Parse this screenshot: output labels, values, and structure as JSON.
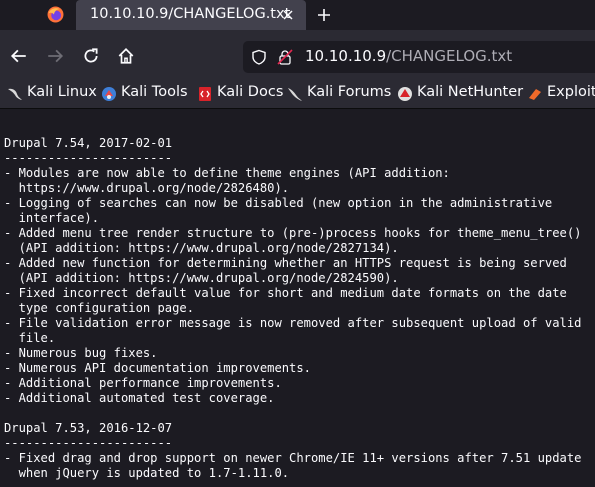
{
  "tab": {
    "title": "10.10.10.9/CHANGELOG.txt"
  },
  "url": {
    "host": "10.10.10.9",
    "path": "/CHANGELOG.txt"
  },
  "bookmarks": [
    {
      "label": "Kali Linux",
      "icon": "kali-dragon-icon"
    },
    {
      "label": "Kali Tools",
      "icon": "kali-tools-icon"
    },
    {
      "label": "Kali Docs",
      "icon": "kali-docs-icon"
    },
    {
      "label": "Kali Forums",
      "icon": "kali-forums-icon"
    },
    {
      "label": "Kali NetHunter",
      "icon": "nethunter-icon"
    },
    {
      "label": "Exploit-",
      "icon": "exploit-db-icon"
    }
  ],
  "changelog_lines": [
    "Drupal 7.54, 2017-02-01",
    "-----------------------",
    "- Modules are now able to define theme engines (API addition:",
    "  https://www.drupal.org/node/2826480).",
    "- Logging of searches can now be disabled (new option in the administrative",
    "  interface).",
    "- Added menu tree render structure to (pre-)process hooks for theme_menu_tree()",
    "  (API addition: https://www.drupal.org/node/2827134).",
    "- Added new function for determining whether an HTTPS request is being served",
    "  (API addition: https://www.drupal.org/node/2824590).",
    "- Fixed incorrect default value for short and medium date formats on the date",
    "  type configuration page.",
    "- File validation error message is now removed after subsequent upload of valid",
    "  file.",
    "- Numerous bug fixes.",
    "- Numerous API documentation improvements.",
    "- Additional performance improvements.",
    "- Additional automated test coverage.",
    "",
    "Drupal 7.53, 2016-12-07",
    "-----------------------",
    "- Fixed drag and drop support on newer Chrome/IE 11+ versions after 7.51 update",
    "  when jQuery is updated to 1.7-1.11.0."
  ]
}
